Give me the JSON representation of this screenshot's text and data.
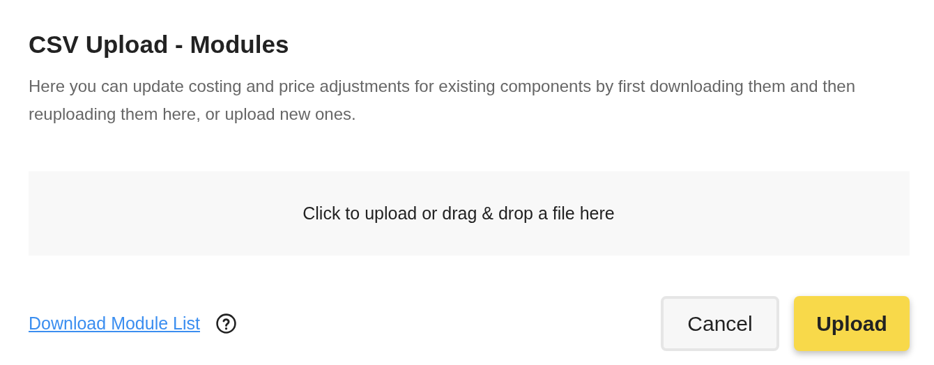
{
  "dialog": {
    "title": "CSV Upload - Modules",
    "description": "Here you can update costing and price adjustments for existing components by first downloading them and then reuploading them here, or upload new ones.",
    "dropzone": {
      "label": "Click to upload or drag & drop a file here"
    },
    "download_link": "Download Module List",
    "buttons": [
      {
        "label": "Cancel",
        "kind": "secondary"
      },
      {
        "label": "Upload",
        "kind": "primary"
      }
    ]
  }
}
